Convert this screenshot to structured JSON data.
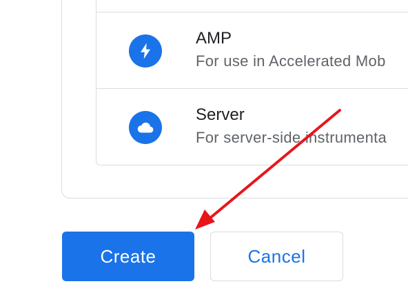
{
  "colors": {
    "accent": "#1a73e8",
    "annotation_arrow": "#e8151b"
  },
  "streams": [
    {
      "title": "AMP",
      "subtitle": "For use in Accelerated Mob",
      "icon": "lightning-bolt-icon"
    },
    {
      "title": "Server",
      "subtitle": "For server-side instrumenta",
      "icon": "cloud-icon"
    }
  ],
  "actions": {
    "create_label": "Create",
    "cancel_label": "Cancel"
  }
}
